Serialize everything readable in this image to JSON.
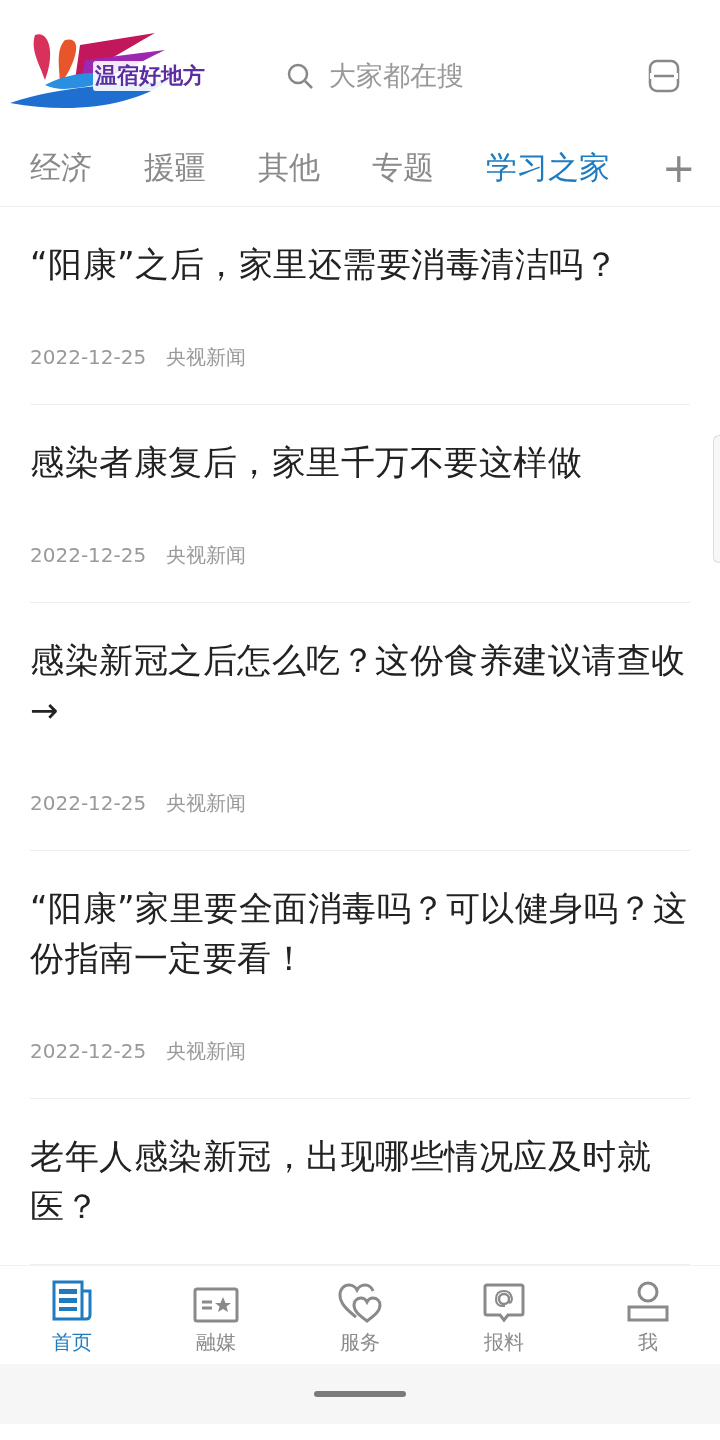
{
  "header": {
    "logo_text": "温宿好地方",
    "search": {
      "placeholder": "大家都在搜"
    }
  },
  "tabs": [
    {
      "label": "经济",
      "selected": false
    },
    {
      "label": "援疆",
      "selected": false
    },
    {
      "label": "其他",
      "selected": false
    },
    {
      "label": "专题",
      "selected": false
    },
    {
      "label": "学习之家",
      "selected": true
    }
  ],
  "add_tab": "+",
  "articles": [
    {
      "title": "“阳康”之后，家里还需要消毒清洁吗？",
      "date": "2022-12-25",
      "source": "央视新闻"
    },
    {
      "title": "感染者康复后，家里千万不要这样做",
      "date": "2022-12-25",
      "source": "央视新闻"
    },
    {
      "title": "感染新冠之后怎么吃？这份食养建议请查收→",
      "date": "2022-12-25",
      "source": "央视新闻"
    },
    {
      "title": "“阳康”家里要全面消毒吗？可以健身吗？这份指南一定要看！",
      "date": "2022-12-25",
      "source": "央视新闻"
    },
    {
      "title": "老年人感染新冠，出现哪些情况应及时就医？"
    }
  ],
  "bottom_nav": [
    {
      "label": "首页",
      "selected": true
    },
    {
      "label": "融媒",
      "selected": false
    },
    {
      "label": "服务",
      "selected": false
    },
    {
      "label": "报料",
      "selected": false
    },
    {
      "label": "我",
      "selected": false
    }
  ]
}
